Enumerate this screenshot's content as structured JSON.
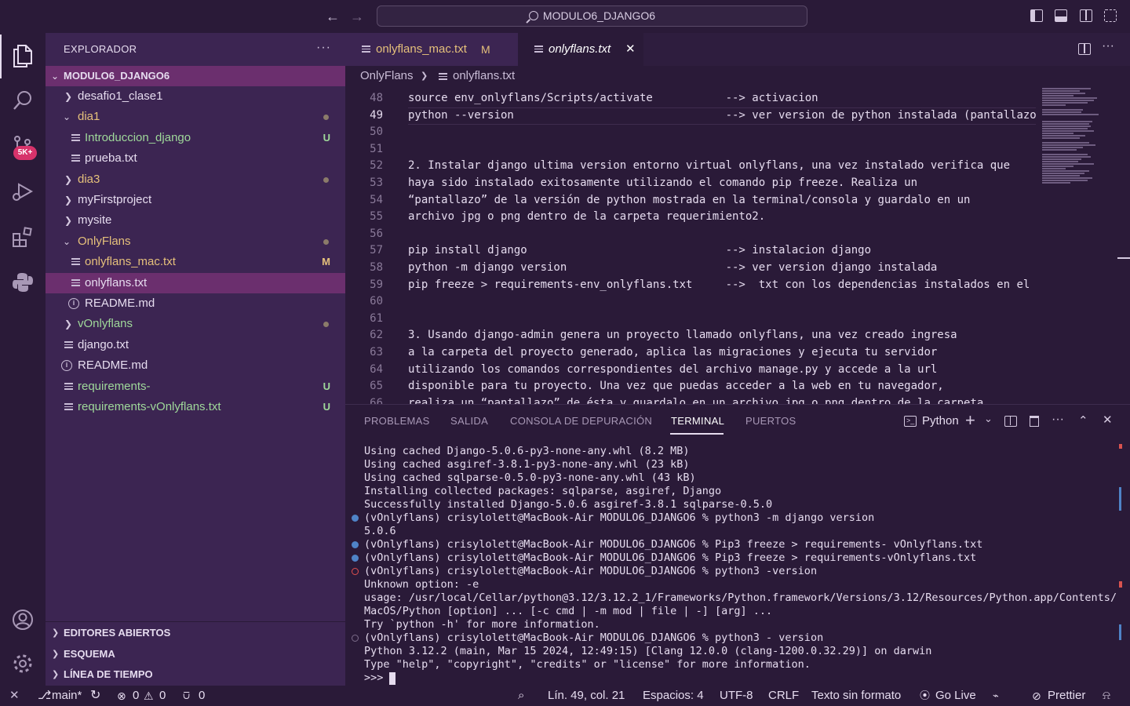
{
  "titlebar": {
    "search": "MODULO6_DJANGO6"
  },
  "activity": {
    "badge": "5K+"
  },
  "explorer": {
    "title": "EXPLORADOR",
    "more": "···",
    "root": "MODULO6_DJANGO6",
    "items": [
      {
        "label": "desafio1_clase1",
        "mark": ""
      },
      {
        "label": "dia1",
        "mark": ""
      },
      {
        "label": "Introduccion_django",
        "mark": "U"
      },
      {
        "label": "prueba.txt",
        "mark": ""
      },
      {
        "label": "dia3",
        "mark": ""
      },
      {
        "label": "myFirstproject",
        "mark": ""
      },
      {
        "label": "mysite",
        "mark": ""
      },
      {
        "label": "OnlyFlans",
        "mark": ""
      },
      {
        "label": "onlyflans_mac.txt",
        "mark": "M"
      },
      {
        "label": "onlyflans.txt",
        "mark": ""
      },
      {
        "label": "README.md",
        "mark": ""
      },
      {
        "label": "vOnlyflans",
        "mark": ""
      },
      {
        "label": "django.txt",
        "mark": ""
      },
      {
        "label": "README.md",
        "mark": ""
      },
      {
        "label": "requirements-",
        "mark": "U"
      },
      {
        "label": "requirements-vOnlyflans.txt",
        "mark": "U"
      }
    ],
    "sections": [
      "EDITORES ABIERTOS",
      "ESQUEMA",
      "LÍNEA DE TIEMPO"
    ]
  },
  "tabs": [
    {
      "label": "onlyflans_mac.txt",
      "badge": "M"
    },
    {
      "label": "onlyflans.txt",
      "badge": "✕"
    }
  ],
  "breadcrumb": {
    "folder": "OnlyFlans",
    "file": "onlyflans.txt"
  },
  "editor": {
    "lines": [
      {
        "n": "48",
        "text": "source env_onlyflans/Scripts/activate           --> activacion"
      },
      {
        "n": "49",
        "text": "python --version                                --> ver version de python instalada (pantallazo)"
      },
      {
        "n": "50",
        "text": ""
      },
      {
        "n": "51",
        "text": ""
      },
      {
        "n": "52",
        "text": "2. Instalar django ultima version entorno virtual onlyflans, una vez instalado verifica que"
      },
      {
        "n": "53",
        "text": "haya sido instalado exitosamente utilizando el comando pip freeze. Realiza un"
      },
      {
        "n": "54",
        "text": "“pantallazo” de la versión de python mostrada en la terminal/consola y guardalo en un"
      },
      {
        "n": "55",
        "text": "archivo jpg o png dentro de la carpeta requerimiento2."
      },
      {
        "n": "56",
        "text": ""
      },
      {
        "n": "57",
        "text": "pip install django                              --> instalacion django"
      },
      {
        "n": "58",
        "text": "python -m django version                        --> ver version django instalada"
      },
      {
        "n": "59",
        "text": "pip freeze > requirements-env_onlyflans.txt     -->  txt con los dependencias instalados en el entorno"
      },
      {
        "n": "60",
        "text": ""
      },
      {
        "n": "61",
        "text": ""
      },
      {
        "n": "62",
        "text": "3. Usando django-admin genera un proyecto llamado onlyflans, una vez creado ingresa"
      },
      {
        "n": "63",
        "text": "a la carpeta del proyecto generado, aplica las migraciones y ejecuta tu servidor"
      },
      {
        "n": "64",
        "text": "utilizando los comandos correspondientes del archivo manage.py y accede a la url"
      },
      {
        "n": "65",
        "text": "disponible para tu proyecto. Una vez que puedas acceder a la web en tu navegador,"
      },
      {
        "n": "66",
        "text": "realiza un “pantallazo” de ésta y guardalo en un archivo jpg o png dentro de la carpeta"
      }
    ]
  },
  "panel": {
    "tabs": [
      "PROBLEMAS",
      "SALIDA",
      "CONSOLA DE DEPURACIÓN",
      "TERMINAL",
      "PUERTOS"
    ],
    "shell": "Python",
    "lines": [
      {
        "dot": "",
        "text": "Using cached Django-5.0.6-py3-none-any.whl (8.2 MB)"
      },
      {
        "dot": "",
        "text": "Using cached asgiref-3.8.1-py3-none-any.whl (23 kB)"
      },
      {
        "dot": "",
        "text": "Using cached sqlparse-0.5.0-py3-none-any.whl (43 kB)"
      },
      {
        "dot": "",
        "text": "Installing collected packages: sqlparse, asgiref, Django"
      },
      {
        "dot": "",
        "text": "Successfully installed Django-5.0.6 asgiref-3.8.1 sqlparse-0.5.0"
      },
      {
        "dot": "blue",
        "text": "(vOnlyflans) crisylolett@MacBook-Air MODULO6_DJANGO6 % python3 -m django version"
      },
      {
        "dot": "",
        "text": "5.0.6"
      },
      {
        "dot": "blue",
        "text": "(vOnlyflans) crisylolett@MacBook-Air MODULO6_DJANGO6 % Pip3 freeze > requirements- vOnlyflans.txt"
      },
      {
        "dot": "blue",
        "text": "(vOnlyflans) crisylolett@MacBook-Air MODULO6_DJANGO6 % Pip3 freeze > requirements-vOnlyflans.txt"
      },
      {
        "dot": "red",
        "text": "(vOnlyflans) crisylolett@MacBook-Air MODULO6_DJANGO6 % python3 -version"
      },
      {
        "dot": "",
        "text": "Unknown option: -e"
      },
      {
        "dot": "",
        "text": "usage: /usr/local/Cellar/python@3.12/3.12.2_1/Frameworks/Python.framework/Versions/3.12/Resources/Python.app/Contents/"
      },
      {
        "dot": "",
        "text": "MacOS/Python [option] ... [-c cmd | -m mod | file | -] [arg] ..."
      },
      {
        "dot": "",
        "text": "Try `python -h' for more information."
      },
      {
        "dot": "hollow",
        "text": "(vOnlyflans) crisylolett@MacBook-Air MODULO6_DJANGO6 % python3 - version"
      },
      {
        "dot": "",
        "text": "Python 3.12.2 (main, Mar 15 2024, 12:49:15) [Clang 12.0.0 (clang-1200.0.32.29)] on darwin"
      },
      {
        "dot": "",
        "text": "Type \"help\", \"copyright\", \"credits\" or \"license\" for more information."
      },
      {
        "dot": "",
        "text": ">>> "
      }
    ]
  },
  "status": {
    "branch": "main*",
    "errors": "0",
    "warnings": "0",
    "ports": "0",
    "position": "Lín. 49, col. 21",
    "spaces": "Espacios: 4",
    "encoding": "UTF-8",
    "eol": "CRLF",
    "language": "Texto sin formato",
    "golive": "Go Live",
    "prettier": "Prettier"
  },
  "colors": {
    "sidebar": "#3c2552",
    "selection": "#6b2f6e",
    "background": "#2a1a38",
    "badge": "#d7336b"
  }
}
